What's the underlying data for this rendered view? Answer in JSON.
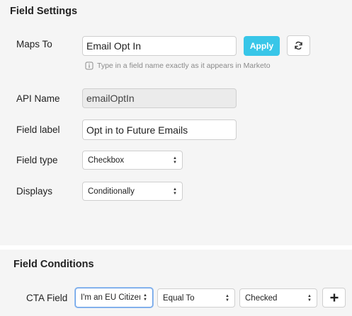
{
  "field_settings": {
    "title": "Field Settings",
    "maps_to": {
      "label": "Maps To",
      "value": "Email Opt In",
      "apply_label": "Apply",
      "refresh_icon": "refresh-icon",
      "hint": "Type in a field name exactly as it appears in Marketo",
      "hint_icon": "info-icon"
    },
    "api_name": {
      "label": "API Name",
      "value": "emailOptIn"
    },
    "field_label": {
      "label": "Field label",
      "value": "Opt in to Future Emails"
    },
    "field_type": {
      "label": "Field type",
      "value": "Checkbox"
    },
    "displays": {
      "label": "Displays",
      "value": "Conditionally"
    }
  },
  "field_conditions": {
    "title": "Field Conditions",
    "cta_field": {
      "label": "CTA Field",
      "field_value": "I'm an EU Citizen",
      "operator_value": "Equal To",
      "state_value": "Checked",
      "add_icon": "plus-icon"
    }
  },
  "colors": {
    "accent": "#38c6e8",
    "panel_bg": "#f5f5f5",
    "focus_border": "#6aa0e6"
  }
}
